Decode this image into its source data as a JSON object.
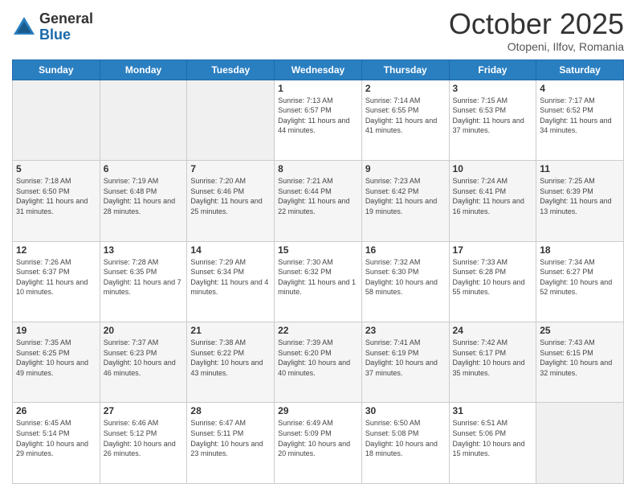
{
  "logo": {
    "general": "General",
    "blue": "Blue"
  },
  "header": {
    "month": "October 2025",
    "location": "Otopeni, Ilfov, Romania"
  },
  "weekdays": [
    "Sunday",
    "Monday",
    "Tuesday",
    "Wednesday",
    "Thursday",
    "Friday",
    "Saturday"
  ],
  "weeks": [
    [
      {
        "day": "",
        "info": ""
      },
      {
        "day": "",
        "info": ""
      },
      {
        "day": "",
        "info": ""
      },
      {
        "day": "1",
        "info": "Sunrise: 7:13 AM\nSunset: 6:57 PM\nDaylight: 11 hours and 44 minutes."
      },
      {
        "day": "2",
        "info": "Sunrise: 7:14 AM\nSunset: 6:55 PM\nDaylight: 11 hours and 41 minutes."
      },
      {
        "day": "3",
        "info": "Sunrise: 7:15 AM\nSunset: 6:53 PM\nDaylight: 11 hours and 37 minutes."
      },
      {
        "day": "4",
        "info": "Sunrise: 7:17 AM\nSunset: 6:52 PM\nDaylight: 11 hours and 34 minutes."
      }
    ],
    [
      {
        "day": "5",
        "info": "Sunrise: 7:18 AM\nSunset: 6:50 PM\nDaylight: 11 hours and 31 minutes."
      },
      {
        "day": "6",
        "info": "Sunrise: 7:19 AM\nSunset: 6:48 PM\nDaylight: 11 hours and 28 minutes."
      },
      {
        "day": "7",
        "info": "Sunrise: 7:20 AM\nSunset: 6:46 PM\nDaylight: 11 hours and 25 minutes."
      },
      {
        "day": "8",
        "info": "Sunrise: 7:21 AM\nSunset: 6:44 PM\nDaylight: 11 hours and 22 minutes."
      },
      {
        "day": "9",
        "info": "Sunrise: 7:23 AM\nSunset: 6:42 PM\nDaylight: 11 hours and 19 minutes."
      },
      {
        "day": "10",
        "info": "Sunrise: 7:24 AM\nSunset: 6:41 PM\nDaylight: 11 hours and 16 minutes."
      },
      {
        "day": "11",
        "info": "Sunrise: 7:25 AM\nSunset: 6:39 PM\nDaylight: 11 hours and 13 minutes."
      }
    ],
    [
      {
        "day": "12",
        "info": "Sunrise: 7:26 AM\nSunset: 6:37 PM\nDaylight: 11 hours and 10 minutes."
      },
      {
        "day": "13",
        "info": "Sunrise: 7:28 AM\nSunset: 6:35 PM\nDaylight: 11 hours and 7 minutes."
      },
      {
        "day": "14",
        "info": "Sunrise: 7:29 AM\nSunset: 6:34 PM\nDaylight: 11 hours and 4 minutes."
      },
      {
        "day": "15",
        "info": "Sunrise: 7:30 AM\nSunset: 6:32 PM\nDaylight: 11 hours and 1 minute."
      },
      {
        "day": "16",
        "info": "Sunrise: 7:32 AM\nSunset: 6:30 PM\nDaylight: 10 hours and 58 minutes."
      },
      {
        "day": "17",
        "info": "Sunrise: 7:33 AM\nSunset: 6:28 PM\nDaylight: 10 hours and 55 minutes."
      },
      {
        "day": "18",
        "info": "Sunrise: 7:34 AM\nSunset: 6:27 PM\nDaylight: 10 hours and 52 minutes."
      }
    ],
    [
      {
        "day": "19",
        "info": "Sunrise: 7:35 AM\nSunset: 6:25 PM\nDaylight: 10 hours and 49 minutes."
      },
      {
        "day": "20",
        "info": "Sunrise: 7:37 AM\nSunset: 6:23 PM\nDaylight: 10 hours and 46 minutes."
      },
      {
        "day": "21",
        "info": "Sunrise: 7:38 AM\nSunset: 6:22 PM\nDaylight: 10 hours and 43 minutes."
      },
      {
        "day": "22",
        "info": "Sunrise: 7:39 AM\nSunset: 6:20 PM\nDaylight: 10 hours and 40 minutes."
      },
      {
        "day": "23",
        "info": "Sunrise: 7:41 AM\nSunset: 6:19 PM\nDaylight: 10 hours and 37 minutes."
      },
      {
        "day": "24",
        "info": "Sunrise: 7:42 AM\nSunset: 6:17 PM\nDaylight: 10 hours and 35 minutes."
      },
      {
        "day": "25",
        "info": "Sunrise: 7:43 AM\nSunset: 6:15 PM\nDaylight: 10 hours and 32 minutes."
      }
    ],
    [
      {
        "day": "26",
        "info": "Sunrise: 6:45 AM\nSunset: 5:14 PM\nDaylight: 10 hours and 29 minutes."
      },
      {
        "day": "27",
        "info": "Sunrise: 6:46 AM\nSunset: 5:12 PM\nDaylight: 10 hours and 26 minutes."
      },
      {
        "day": "28",
        "info": "Sunrise: 6:47 AM\nSunset: 5:11 PM\nDaylight: 10 hours and 23 minutes."
      },
      {
        "day": "29",
        "info": "Sunrise: 6:49 AM\nSunset: 5:09 PM\nDaylight: 10 hours and 20 minutes."
      },
      {
        "day": "30",
        "info": "Sunrise: 6:50 AM\nSunset: 5:08 PM\nDaylight: 10 hours and 18 minutes."
      },
      {
        "day": "31",
        "info": "Sunrise: 6:51 AM\nSunset: 5:06 PM\nDaylight: 10 hours and 15 minutes."
      },
      {
        "day": "",
        "info": ""
      }
    ]
  ]
}
